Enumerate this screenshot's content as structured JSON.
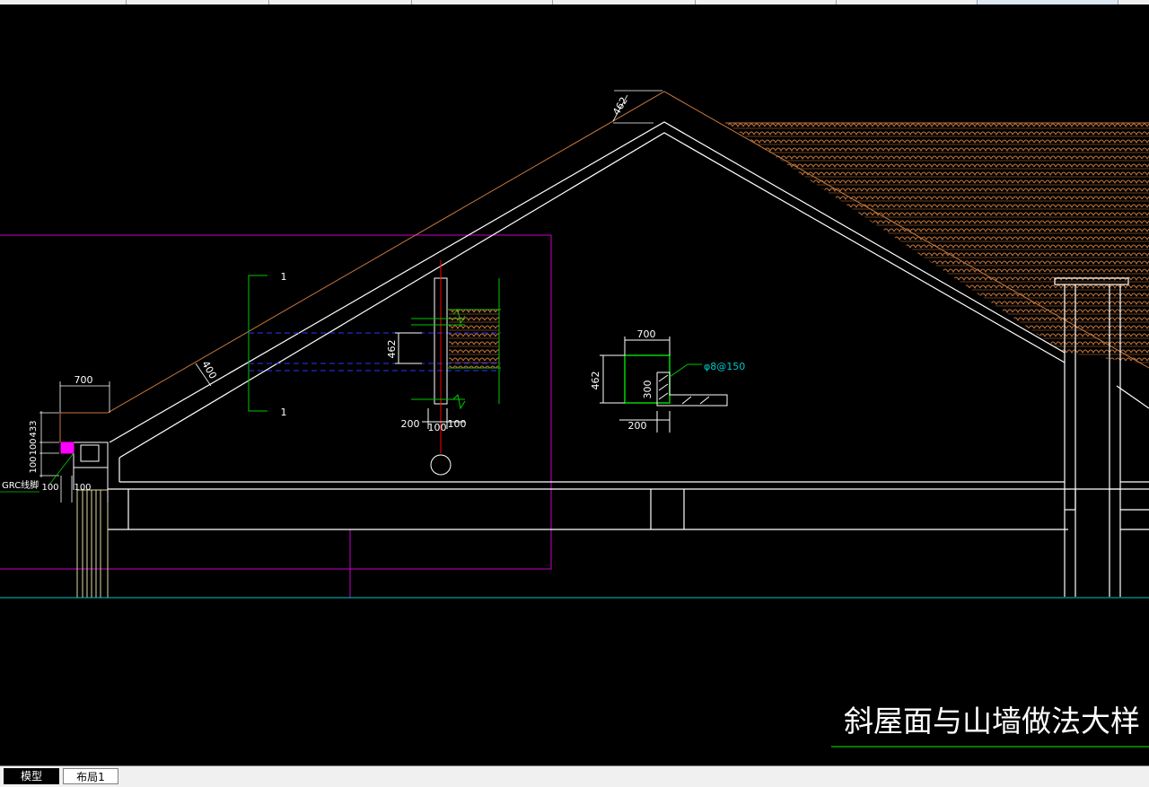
{
  "drawing": {
    "title": "斜屋面与山墙做法大样",
    "dims": {
      "ridge_dim": "462",
      "slope_dim": "400",
      "eave_width": "700",
      "eave_h_a": "100",
      "eave_h_b": "433",
      "eave_h_c": "100",
      "eave_h_d": "100",
      "eave_w_a": "100",
      "eave_w_b": "100",
      "grc_label": "GRC线脚",
      "sect_height": "462",
      "sect_mark_top": "1",
      "sect_mark_bot": "1",
      "sect_w_a": "200",
      "sect_w_b": "100",
      "sect_w_c": "100",
      "box_width": "700",
      "box_height": "462",
      "box_inner": "300",
      "box_base": "200",
      "rebar": "φ8@150"
    }
  },
  "tabs": {
    "model": "模型",
    "layout1": "布局1"
  },
  "colors": {
    "background": "#000000",
    "line_white": "#ffffff",
    "roof_orange": "#c8783c",
    "magenta": "#c800c8",
    "green": "#00c800",
    "blue_dashed": "#3232ff",
    "cyan": "#00c8c8",
    "red": "#ff0000"
  }
}
